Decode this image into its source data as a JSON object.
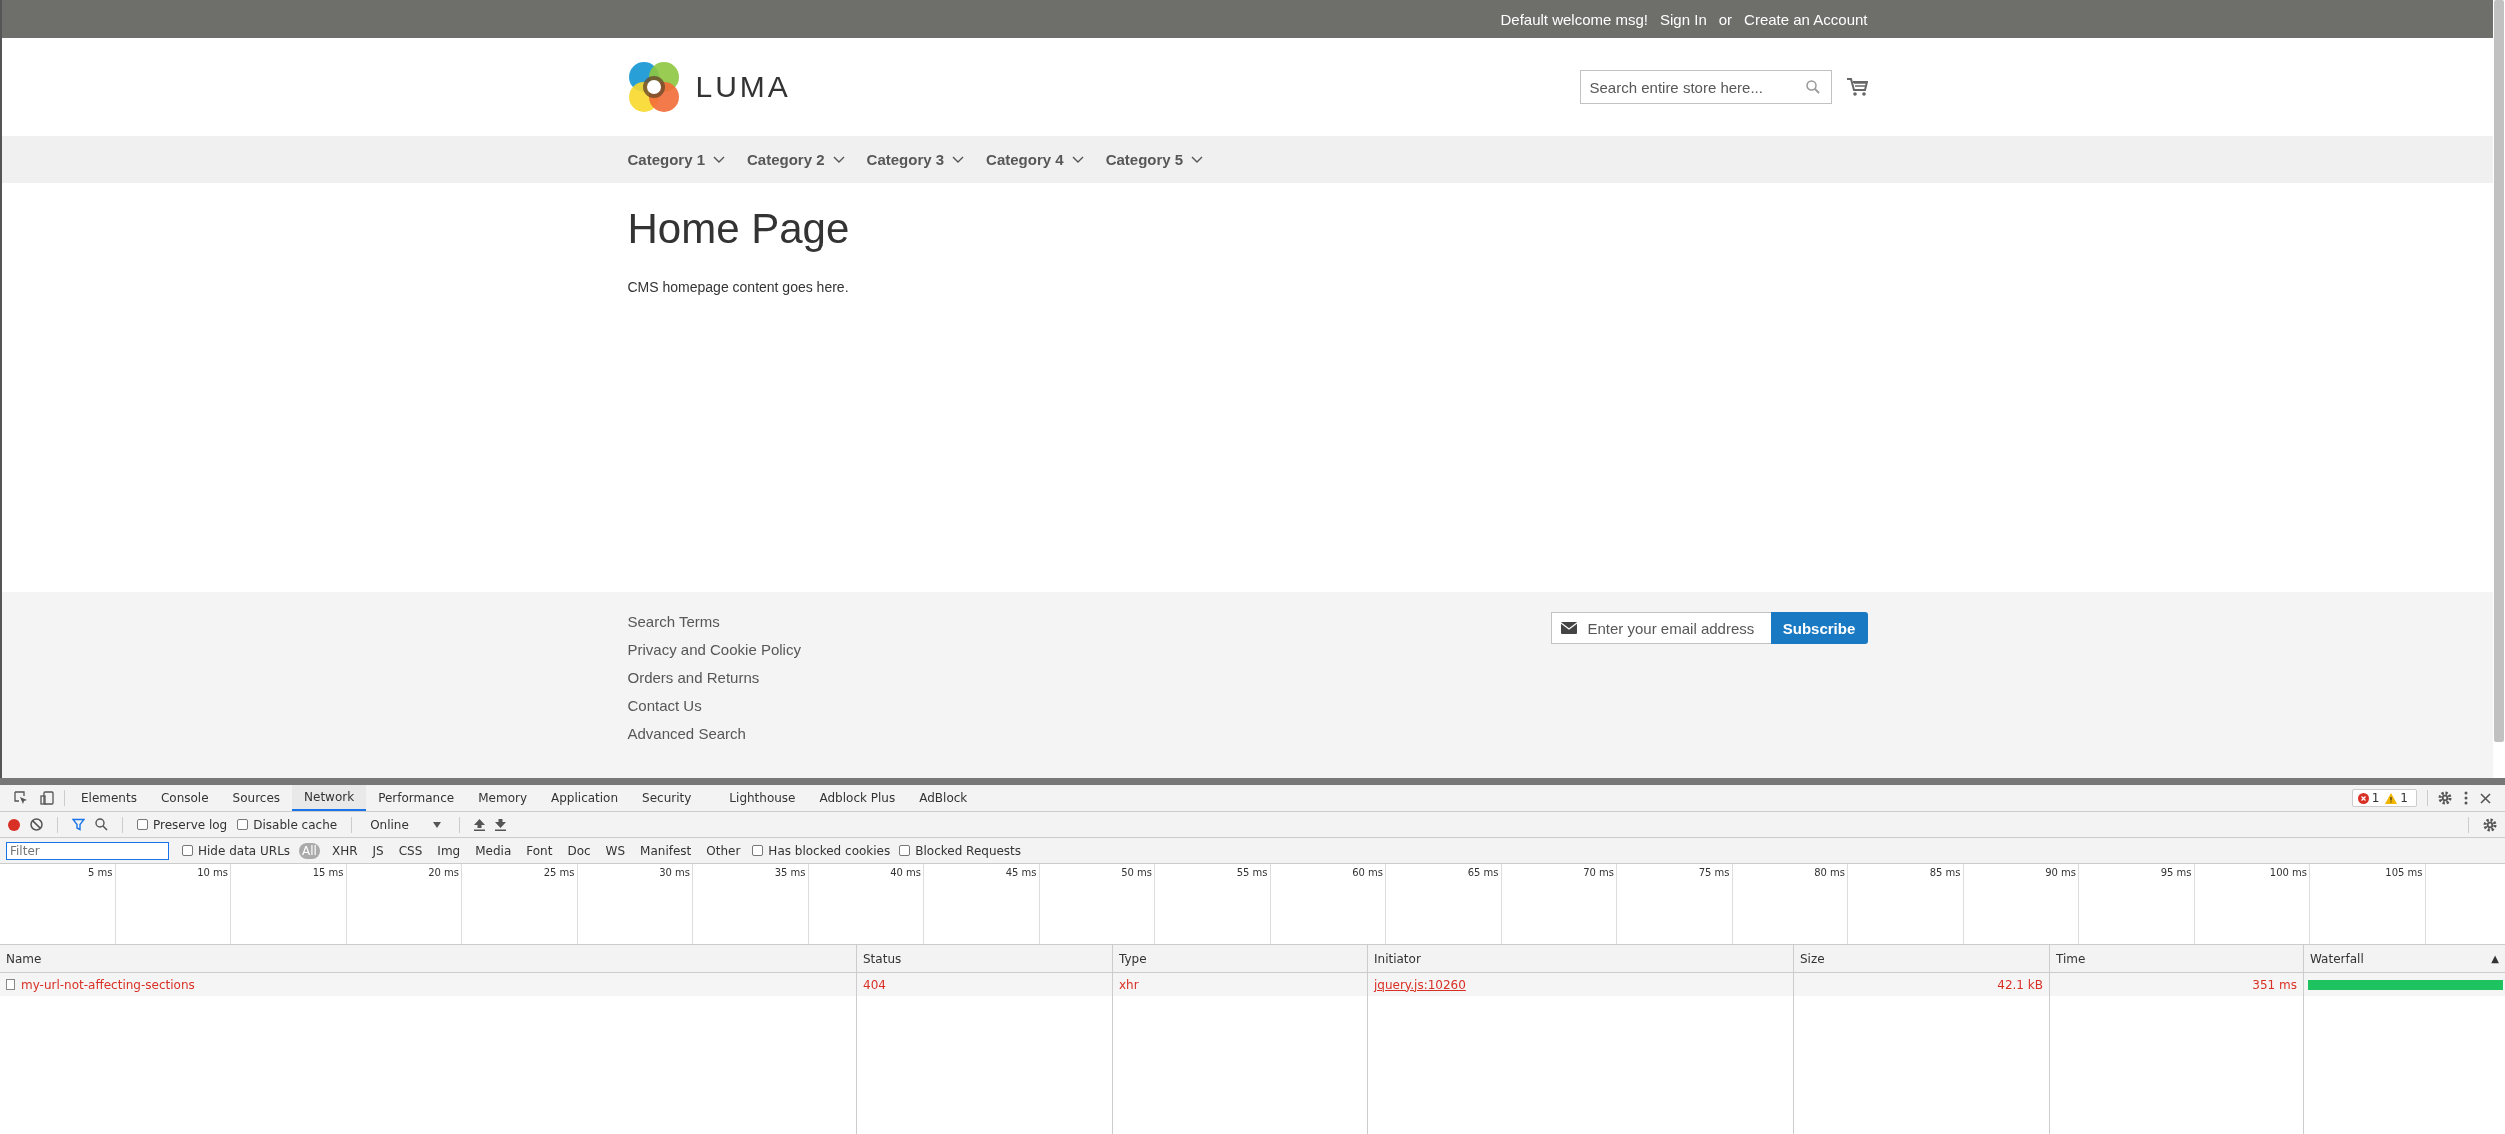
{
  "top_bar": {
    "welcome": "Default welcome msg!",
    "links": [
      {
        "label": "Sign In"
      },
      {
        "label": "Create an Account"
      }
    ],
    "separator": "or"
  },
  "header": {
    "logo_text": "LUMA",
    "search": {
      "placeholder": "Search entire store here..."
    }
  },
  "nav": [
    {
      "label": "Category 1"
    },
    {
      "label": "Category 2"
    },
    {
      "label": "Category 3"
    },
    {
      "label": "Category 4"
    },
    {
      "label": "Category 5"
    }
  ],
  "page": {
    "title": "Home Page",
    "body": "CMS homepage content goes here."
  },
  "footer": {
    "links": [
      "Search Terms",
      "Privacy and Cookie Policy",
      "Orders and Returns",
      "Contact Us",
      "Advanced Search"
    ],
    "newsletter": {
      "placeholder": "Enter your email address",
      "button": "Subscribe"
    }
  },
  "devtools": {
    "tabs": [
      {
        "label": "Elements",
        "selected": false
      },
      {
        "label": "Console",
        "selected": false
      },
      {
        "label": "Sources",
        "selected": false
      },
      {
        "label": "Network",
        "selected": true
      },
      {
        "label": "Performance",
        "selected": false
      },
      {
        "label": "Memory",
        "selected": false
      },
      {
        "label": "Application",
        "selected": false
      },
      {
        "label": "Security",
        "selected": false
      },
      {
        "label": "Lighthouse",
        "selected": false
      },
      {
        "label": "Adblock Plus",
        "selected": false
      },
      {
        "label": "AdBlock",
        "selected": false
      }
    ],
    "errors": "1",
    "warnings": "1",
    "recording": true,
    "toolbar_checkboxes": [
      {
        "label": "Preserve log",
        "checked": false
      },
      {
        "label": "Disable cache",
        "checked": false
      }
    ],
    "throttle": "Online",
    "filter": {
      "placeholder": "Filter"
    },
    "hide_data_urls": {
      "label": "Hide data URLs",
      "checked": false
    },
    "types": [
      {
        "label": "All",
        "selected": true
      },
      {
        "label": "XHR",
        "selected": false
      },
      {
        "label": "JS",
        "selected": false
      },
      {
        "label": "CSS",
        "selected": false
      },
      {
        "label": "Img",
        "selected": false
      },
      {
        "label": "Media",
        "selected": false
      },
      {
        "label": "Font",
        "selected": false
      },
      {
        "label": "Doc",
        "selected": false
      },
      {
        "label": "WS",
        "selected": false
      },
      {
        "label": "Manifest",
        "selected": false
      },
      {
        "label": "Other",
        "selected": false
      }
    ],
    "blocked_checkboxes": [
      {
        "label": "Has blocked cookies",
        "checked": false
      },
      {
        "label": "Blocked Requests",
        "checked": false
      }
    ],
    "timeline_ticks": [
      "5 ms",
      "10 ms",
      "15 ms",
      "20 ms",
      "25 ms",
      "30 ms",
      "35 ms",
      "40 ms",
      "45 ms",
      "50 ms",
      "55 ms",
      "60 ms",
      "65 ms",
      "70 ms",
      "75 ms",
      "80 ms",
      "85 ms",
      "90 ms",
      "95 ms",
      "100 ms",
      "105 ms"
    ],
    "table": {
      "columns": [
        {
          "label": "Name"
        },
        {
          "label": "Status"
        },
        {
          "label": "Type"
        },
        {
          "label": "Initiator"
        },
        {
          "label": "Size"
        },
        {
          "label": "Time"
        },
        {
          "label": "Waterfall",
          "sort_icon": "▲"
        }
      ],
      "rows": [
        {
          "name": "my-url-not-affecting-sections",
          "status": "404",
          "type": "xhr",
          "initiator": "jquery.js:10260",
          "size": "42.1 kB",
          "time": "351 ms",
          "failed": true
        }
      ]
    }
  }
}
